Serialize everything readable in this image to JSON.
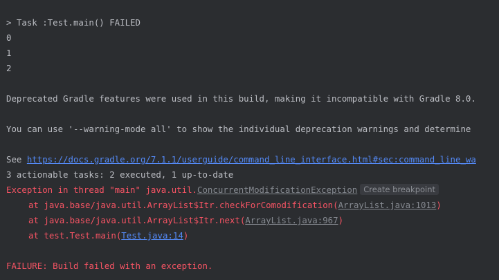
{
  "console": {
    "task_line": "> Task :Test.main() FAILED",
    "output_values": [
      "0",
      "1",
      "2"
    ],
    "deprecated_line": "Deprecated Gradle features were used in this build, making it incompatible with Gradle 8.0.",
    "warning_mode_line": "You can use '--warning-mode all' to show the individual deprecation warnings and determine",
    "see_prefix": "See ",
    "docs_link": "https://docs.gradle.org/7.1.1/userguide/command_line_interface.html#sec:command_line_wa",
    "actionable_tasks": "3 actionable tasks: 2 executed, 1 up-to-date",
    "exception_prefix": "Exception in thread \"main\" java.util.",
    "exception_class": "ConcurrentModificationException",
    "create_breakpoint": "Create breakpoint",
    "stack_frames": [
      {
        "prefix": "at java.base/java.util.ArrayList$Itr.checkForComodification(",
        "location": "ArrayList.java:1013",
        "suffix": ")"
      },
      {
        "prefix": "at java.base/java.util.ArrayList$Itr.next(",
        "location": "ArrayList.java:967",
        "suffix": ")"
      },
      {
        "prefix": "at test.Test.main(",
        "location": "Test.java:14",
        "suffix": ")"
      }
    ],
    "failure_line": "FAILURE: Build failed with an exception."
  },
  "colors": {
    "background": "#2b2d30",
    "text": "#bcbec4",
    "error": "#f75464",
    "link": "#548af7",
    "library_link": "#868a91"
  }
}
